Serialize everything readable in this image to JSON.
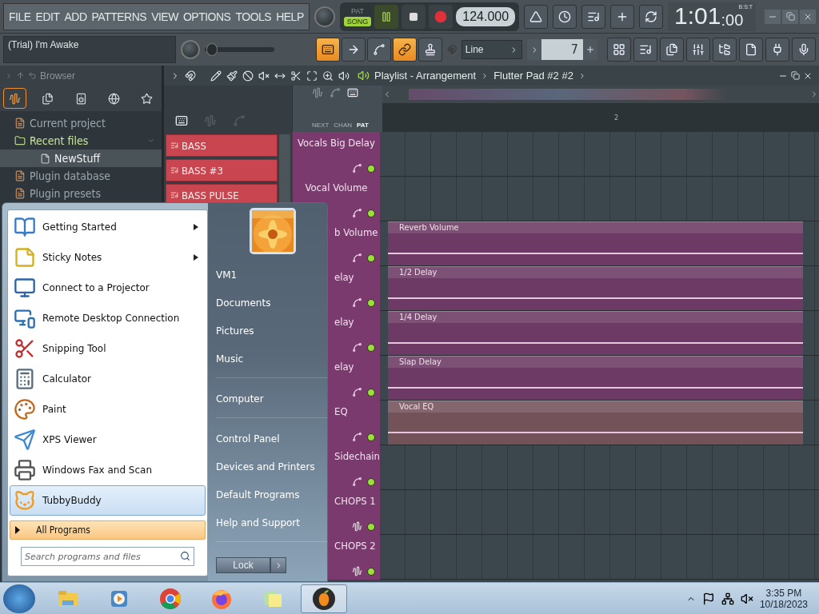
{
  "menu": [
    "FILE",
    "EDIT",
    "ADD",
    "PATTERNS",
    "VIEW",
    "OPTIONS",
    "TOOLS",
    "HELP"
  ],
  "transport": {
    "modes": [
      {
        "label": "PAT",
        "selected": false
      },
      {
        "label": "SONG",
        "selected": true
      }
    ],
    "playing": true,
    "tempo": "124.000"
  },
  "clock": {
    "main": "1:01",
    "sub": ":00",
    "unit": "B:S:T"
  },
  "hint": "(Trial) I'm Awake",
  "master": {
    "level": 0.03
  },
  "tools": [
    {
      "selected": true
    },
    {
      "selected": false
    },
    {
      "selected": false
    },
    {
      "selected": true
    },
    {
      "selected": false
    }
  ],
  "snap": {
    "value": "Line"
  },
  "step": {
    "value": "7"
  },
  "browser": {
    "title": "Browser",
    "tabs": [
      {
        "selected": true
      },
      {
        "selected": false
      },
      {
        "selected": false
      },
      {
        "selected": false
      },
      {
        "selected": false
      }
    ],
    "items": [
      {
        "label": "Current project",
        "expanded": false
      },
      {
        "label": "Recent files",
        "expanded": true,
        "children": [
          {
            "label": "NewStuff",
            "selected": true
          }
        ]
      },
      {
        "label": "Plugin database",
        "expanded": false
      },
      {
        "label": "Plugin presets",
        "expanded": false
      }
    ]
  },
  "playlist": {
    "title": "Playlist - Arrangement",
    "pattern": "Flutter Pad #2 #2",
    "picker_tabs": [
      {
        "label": "NEXT",
        "selected": false
      },
      {
        "label": "CHAN",
        "selected": false
      },
      {
        "label": "PAT",
        "selected": true
      }
    ],
    "patterns": [
      "BASS",
      "BASS #3",
      "BASS PULSE"
    ],
    "ruler": [
      "2"
    ],
    "tracks": [
      {
        "label": "Vocals Big Delay",
        "kind": "automation",
        "on": true
      },
      {
        "label": "Vocal Volume",
        "kind": "automation",
        "on": true
      },
      {
        "label": "b Volume",
        "kind": "automation",
        "on": true,
        "clip": {
          "label": "Reverb Volume",
          "color": "#6c3a64"
        }
      },
      {
        "label": "elay",
        "kind": "automation",
        "on": true,
        "clip": {
          "label": "1/2 Delay",
          "color": "#6c3a64"
        }
      },
      {
        "label": "elay",
        "kind": "automation",
        "on": true,
        "clip": {
          "label": "1/4 Delay",
          "color": "#6c3a64"
        }
      },
      {
        "label": "elay",
        "kind": "automation",
        "on": true,
        "clip": {
          "label": "Slap Delay",
          "color": "#6c3a64"
        }
      },
      {
        "label": "EQ",
        "kind": "automation",
        "on": true,
        "clip": {
          "label": "Vocal EQ",
          "color": "#74525a"
        }
      },
      {
        "label": "Sidechain",
        "kind": "automation",
        "on": true
      },
      {
        "label": "CHOPS 1",
        "kind": "audio",
        "on": true
      },
      {
        "label": "CHOPS 2",
        "kind": "audio",
        "on": true
      }
    ]
  },
  "start_menu": {
    "programs": [
      {
        "label": "Getting Started",
        "submenu": true,
        "selected": false
      },
      {
        "label": "Sticky Notes",
        "submenu": true,
        "selected": false
      },
      {
        "label": "Connect to a Projector",
        "submenu": false,
        "selected": false
      },
      {
        "label": "Remote Desktop Connection",
        "submenu": false,
        "selected": false
      },
      {
        "label": "Snipping Tool",
        "submenu": false,
        "selected": false
      },
      {
        "label": "Calculator",
        "submenu": false,
        "selected": false
      },
      {
        "label": "Paint",
        "submenu": false,
        "selected": false
      },
      {
        "label": "XPS Viewer",
        "submenu": false,
        "selected": false
      },
      {
        "label": "Windows Fax and Scan",
        "submenu": false,
        "selected": false
      },
      {
        "label": "TubbyBuddy",
        "submenu": false,
        "selected": true
      }
    ],
    "all_programs": "All Programs",
    "search": {
      "placeholder": "Search programs and files"
    },
    "places": [
      [
        "VM1",
        "Documents",
        "Pictures",
        "Music"
      ],
      [
        "Computer"
      ],
      [
        "Control Panel",
        "Devices and Printers",
        "Default Programs",
        "Help and Support"
      ]
    ],
    "lock": "Lock"
  },
  "taskbar": {
    "apps": [
      {
        "selected": false
      },
      {
        "selected": false
      },
      {
        "selected": false
      },
      {
        "selected": false
      },
      {
        "selected": false
      },
      {
        "selected": true
      }
    ],
    "time": "3:35 PM",
    "date": "10/18/2023"
  }
}
